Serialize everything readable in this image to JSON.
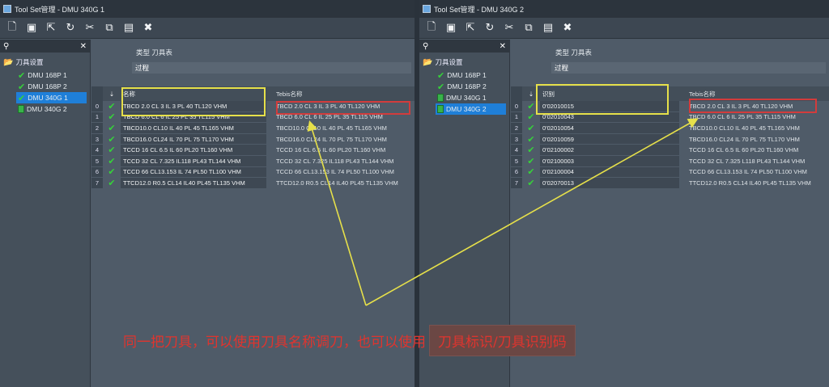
{
  "windows": [
    {
      "title": "Tool Set管理 - DMU 340G 1",
      "tree_root": "刀具设置",
      "tree_items": [
        {
          "label": "DMU 168P 1",
          "icon": "check",
          "selected": false
        },
        {
          "label": "DMU 168P 2",
          "icon": "check",
          "selected": false
        },
        {
          "label": "DMU 340G 1",
          "icon": "check-square",
          "selected": true
        },
        {
          "label": "DMU 340G 2",
          "icon": "square",
          "selected": false
        }
      ],
      "type_label": "类型 刀具表",
      "filter_label": "过程",
      "col_name": "名称",
      "col_tebis": "Tebis名称",
      "rows": [
        {
          "idx": "0",
          "name": "TBCD 2.0 CL 3  IL 3  PL 40 TL120 VHM",
          "tebis": "TBCD 2.0 CL 3  IL 3  PL 40 TL120 VHM"
        },
        {
          "idx": "1",
          "name": "TBCD 6.0 CL 6  IL 25  PL 35 TL115 VHM",
          "tebis": "TBCD 6.0 CL 6  IL 25  PL 35 TL115 VHM"
        },
        {
          "idx": "2",
          "name": "TBCD10.0 CL10  IL 40  PL 45 TL165 VHM",
          "tebis": "TBCD10.0 CL10  IL 40  PL 45 TL165 VHM"
        },
        {
          "idx": "3",
          "name": "TBCD16.0 CL24  IL 70  PL 75 TL170 VHM",
          "tebis": "TBCD16.0 CL24  IL 70  PL 75 TL170 VHM"
        },
        {
          "idx": "4",
          "name": "TCCD 16 CL 6.5  IL 60 PL20 TL160 VHM",
          "tebis": "TCCD 16 CL 6.5  IL 60 PL20 TL160 VHM"
        },
        {
          "idx": "5",
          "name": "TCCD 32 CL 7.325 IL118 PL43 TL144 VHM",
          "tebis": "TCCD 32 CL 7.325 IL118 PL43 TL144 VHM"
        },
        {
          "idx": "6",
          "name": "TCCD 66 CL13.153 IL 74 PL50 TL100 VHM",
          "tebis": "TCCD 66 CL13.153 IL 74 PL50 TL100 VHM"
        },
        {
          "idx": "7",
          "name": "TTCD12.0 R0.5 CL14  IL40  PL45 TL135 VHM",
          "tebis": "TTCD12.0 R0.5 CL14  IL40  PL45 TL135 VHM"
        }
      ]
    },
    {
      "title": "Tool Set管理 - DMU 340G 2",
      "tree_root": "刀具设置",
      "tree_items": [
        {
          "label": "DMU 168P 1",
          "icon": "check",
          "selected": false
        },
        {
          "label": "DMU 168P 2",
          "icon": "check",
          "selected": false
        },
        {
          "label": "DMU 340G 1",
          "icon": "check-square",
          "selected": false
        },
        {
          "label": "DMU 340G 2",
          "icon": "square",
          "selected": true
        }
      ],
      "type_label": "类型 刀具表",
      "filter_label": "过程",
      "col_name": "识别",
      "col_tebis": "Tebis名称",
      "rows": [
        {
          "idx": "0",
          "name": "0'02010015",
          "tebis": "TBCD 2.0 CL 3  IL 3  PL 40 TL120 VHM"
        },
        {
          "idx": "1",
          "name": "0'02010043",
          "tebis": "TBCD 6.0 CL 6  IL 25  PL 35 TL115 VHM"
        },
        {
          "idx": "2",
          "name": "0'02010054",
          "tebis": "TBCD10.0 CL10  IL 40  PL 45 TL165 VHM"
        },
        {
          "idx": "3",
          "name": "0'02010059",
          "tebis": "TBCD16.0 CL24  IL 70  PL 75 TL170 VHM"
        },
        {
          "idx": "4",
          "name": "0'02100002",
          "tebis": "TCCD 16 CL 6.5  IL 60 PL20 TL160 VHM"
        },
        {
          "idx": "5",
          "name": "0'02100003",
          "tebis": "TCCD 32 CL 7.325 L118 PL43 TL144 VHM"
        },
        {
          "idx": "6",
          "name": "0'02100004",
          "tebis": "TCCD 66 CL13.153 IL 74 PL50 TL100 VHM"
        },
        {
          "idx": "7",
          "name": "0'02070013",
          "tebis": "TTCD12.0 R0.5 CL14  IL40  PL45 TL135 VHM"
        }
      ]
    }
  ],
  "caption": {
    "text": "同一把刀具，可以使用刀具名称调刀，也可以使用",
    "highlight": "刀具标识/刀具识别码"
  },
  "colors": {
    "highlight_yellow": "#e6e04a",
    "highlight_red": "#d23c3c",
    "caption_red": "#e0342e",
    "selection_blue": "#1f7fd8"
  },
  "toolbar_icons": [
    "new-file-icon",
    "save-icon",
    "export-icon",
    "refresh-icon",
    "cut-icon",
    "copy-icon",
    "paste-icon",
    "delete-icon"
  ]
}
